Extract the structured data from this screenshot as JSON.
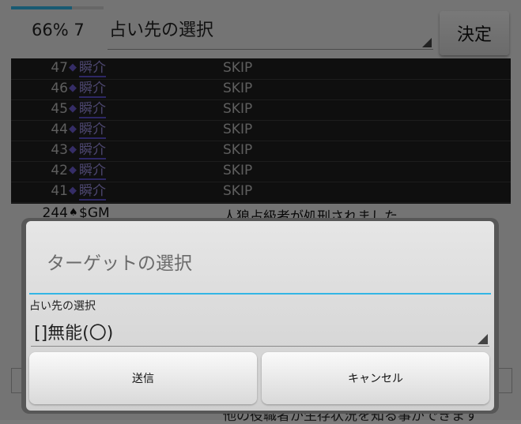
{
  "header": {
    "progress_fraction": 0.66,
    "percent_text": "66% 7",
    "spinner_value": "占い先の選択",
    "decide_label": "決定"
  },
  "log": {
    "rows": [
      {
        "num": "47",
        "icon": "◆",
        "name": "瞬介",
        "msg": "SKIP"
      },
      {
        "num": "46",
        "icon": "◆",
        "name": "瞬介",
        "msg": "SKIP"
      },
      {
        "num": "45",
        "icon": "◆",
        "name": "瞬介",
        "msg": "SKIP"
      },
      {
        "num": "44",
        "icon": "◆",
        "name": "瞬介",
        "msg": "SKIP"
      },
      {
        "num": "43",
        "icon": "◆",
        "name": "瞬介",
        "msg": "SKIP"
      },
      {
        "num": "42",
        "icon": "◆",
        "name": "瞬介",
        "msg": "SKIP"
      },
      {
        "num": "41",
        "icon": "◆",
        "name": "瞬介",
        "msg": "SKIP"
      }
    ],
    "partial_row": {
      "num": "244",
      "icon": "♠",
      "name": "$GM",
      "msg": "人狼占級者が処刑されました"
    },
    "bottom_partial_text": "他の役職者が生存状況を知る事ができます"
  },
  "dialog": {
    "title": "ターゲットの選択",
    "field_label": "占い先の選択",
    "selected_value": "[]無能(〇)",
    "send_label": "送信",
    "cancel_label": "キャンセル"
  },
  "colors": {
    "accent": "#33b5e5",
    "diamond": "#6a5acd",
    "log_bg": "#1e1e1e"
  }
}
